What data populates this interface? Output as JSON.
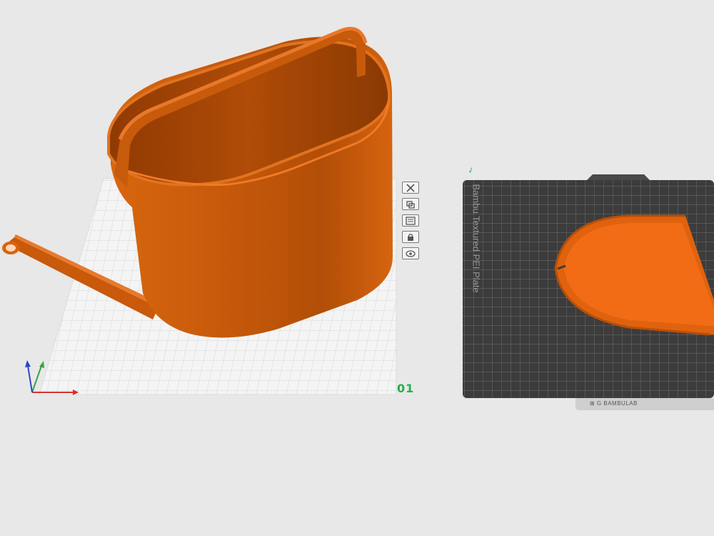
{
  "scene": {
    "background": "#e8e8e8",
    "filament_color": "#e0620e",
    "accent_color": "#21b14b"
  },
  "plate1": {
    "number": "01",
    "toolbar": [
      {
        "name": "delete-plate-button",
        "icon": "close-icon"
      },
      {
        "name": "arrange-plate-button",
        "icon": "arrange-icon"
      },
      {
        "name": "plate-settings-button",
        "icon": "settings-icon"
      },
      {
        "name": "lock-plate-button",
        "icon": "lock-icon"
      },
      {
        "name": "preview-plate-button",
        "icon": "eye-icon"
      }
    ]
  },
  "plate2": {
    "label": "Bambu Textured PEI Plate",
    "brand": "⊞ G BAMBULAB"
  }
}
